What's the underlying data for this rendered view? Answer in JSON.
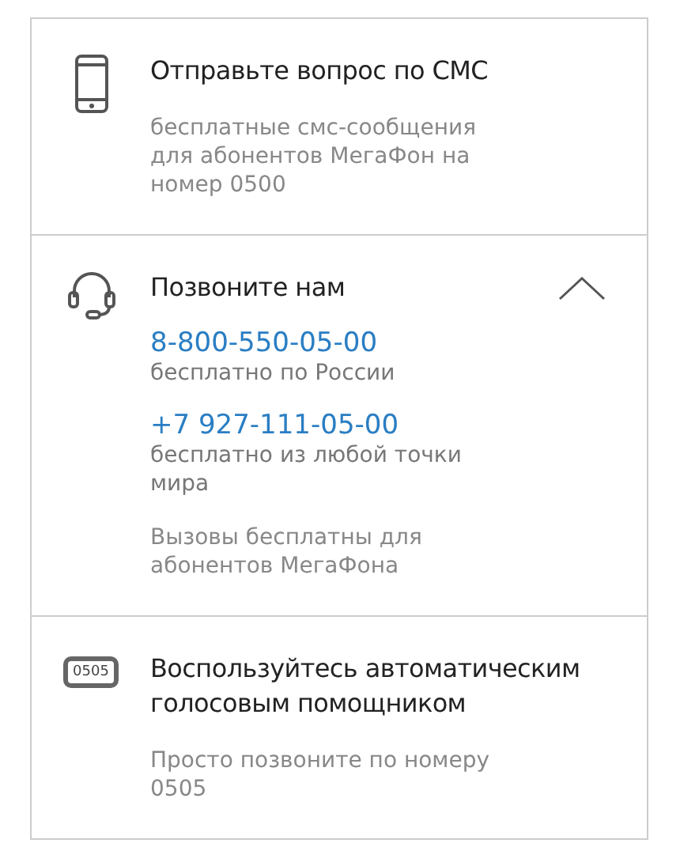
{
  "sections": [
    {
      "kind": "sms",
      "title": "Отправьте вопрос по СМС",
      "description": "бесплатные смс-сообщения\nдля абонентов МегаФон на\nномер 0500"
    },
    {
      "kind": "call",
      "title": "Позвоните нам",
      "expanded": true,
      "phones": [
        {
          "number": "8-800-550-05-00",
          "note": "бесплатно по России"
        },
        {
          "number": "+7 927-111-05-00",
          "note": "бесплатно из любой точки\nмира"
        }
      ],
      "description": "Вызовы бесплатны для\nабонентов МегаФона"
    },
    {
      "kind": "voice",
      "icon_text": "0505",
      "title": "Воспользуйтесь автоматическим\nголосовым помощником",
      "description": "Просто позвоните по номеру\n0505"
    }
  ]
}
